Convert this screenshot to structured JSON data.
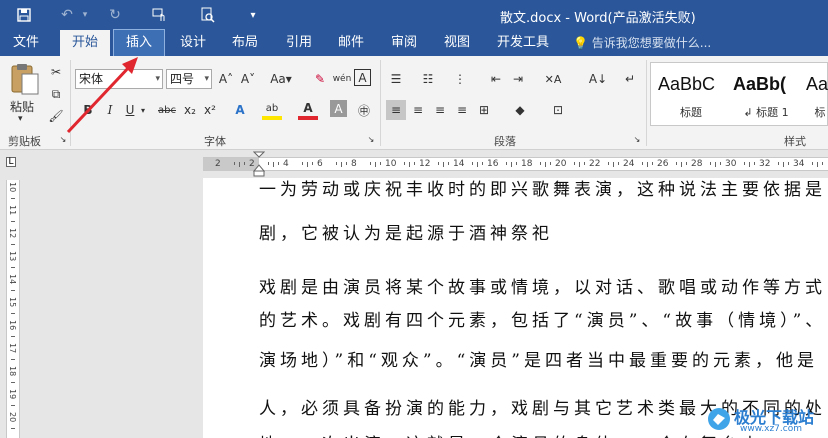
{
  "title_bar": {
    "title": "散文.docx - Word(产品激活失败)",
    "bg_color": "#2b579a",
    "quick_access": [
      {
        "name": "save-icon",
        "glyph": "💾"
      },
      {
        "name": "undo-icon",
        "glyph": "↶"
      },
      {
        "name": "redo-icon",
        "glyph": "↻"
      },
      {
        "name": "touch-mode-icon",
        "glyph": "☝"
      },
      {
        "name": "print-preview-icon",
        "glyph": "🔍"
      },
      {
        "name": "customize-icon",
        "glyph": "▾"
      }
    ]
  },
  "tabs": [
    {
      "label": "文件",
      "state": ""
    },
    {
      "label": "开始",
      "state": "active"
    },
    {
      "label": "插入",
      "state": "highlighted"
    },
    {
      "label": "设计",
      "state": ""
    },
    {
      "label": "布局",
      "state": ""
    },
    {
      "label": "引用",
      "state": ""
    },
    {
      "label": "邮件",
      "state": ""
    },
    {
      "label": "审阅",
      "state": ""
    },
    {
      "label": "视图",
      "state": ""
    },
    {
      "label": "开发工具",
      "state": ""
    }
  ],
  "tell_me": "告诉我您想要做什么...",
  "ribbon": {
    "paste_label": "粘贴",
    "clipboard_label": "剪贴板",
    "font_name": "宋体",
    "font_size": "四号",
    "font_label": "字体",
    "paragraph_label": "段落",
    "styles_label": "样式",
    "font_buttons_row1": [
      "A˄",
      "A˅",
      "Aa▾",
      "✎",
      "wén",
      "A"
    ],
    "font_buttons_row2": [
      "B",
      "I",
      "U",
      "abc",
      "x₂",
      "x²",
      "A",
      "ab",
      "A",
      "A",
      "㊥"
    ],
    "para_buttons_row1": [
      "☰",
      "☷",
      "⋮",
      "⇤",
      "⇥",
      "✕A",
      "A↓",
      "↵"
    ],
    "para_buttons_row2": [
      "≡",
      "≡",
      "≡",
      "≡",
      "⊞",
      "◆",
      "⊡"
    ],
    "styles": [
      {
        "sample": "AaBbC",
        "name": "标题"
      },
      {
        "sample": "AaBb(",
        "name": "↲ 标题 1",
        "bold": true
      },
      {
        "sample": "Aa",
        "name": "标"
      }
    ]
  },
  "ruler": {
    "h_ticks": [
      "2",
      "2",
      "4",
      "6",
      "8",
      "10",
      "12",
      "14",
      "16",
      "18",
      "20",
      "22",
      "24",
      "26",
      "28",
      "30",
      "32",
      "34"
    ],
    "v_ticks": [
      "10",
      "11",
      "12",
      "13",
      "14",
      "15",
      "16",
      "17",
      "18",
      "19",
      "20"
    ]
  },
  "document": {
    "lines": [
      "一为劳动或庆祝丰收时的即兴歌舞表演，这种说法主要依据是",
      "剧，它被认为是起源于酒神祭祀",
      "戏剧是由演员将某个故事或情境，以对话、歌唱或动作等方式",
      "的艺术。戏剧有四个元素，包括了“演员”、“故事（情境）”、",
      "演场地）”和“观众”。“演员”是四者当中最重要的元素，他是",
      "人，必须具备扮演的能力，戏剧与其它艺术类最大的不同的处",
      "地，一次出演，这就是一个演员的身体，一个在舞台上"
    ]
  },
  "watermark": {
    "text": "极光下载站",
    "url_text": "www.xz7.com"
  },
  "colors": {
    "accent": "#2b579a",
    "annotation_arrow": "#e0262e"
  }
}
